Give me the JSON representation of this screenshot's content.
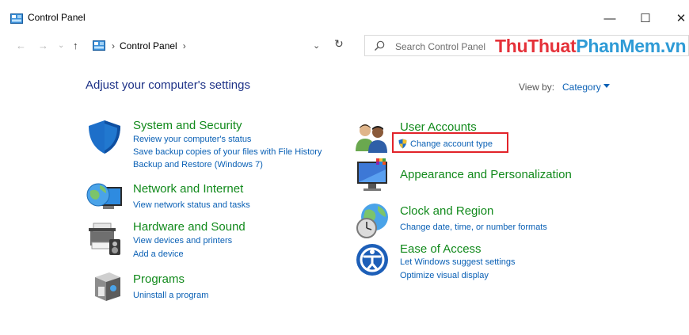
{
  "window": {
    "title": "Control Panel",
    "minimize": "—",
    "maximize": "☐",
    "close": "✕"
  },
  "nav": {
    "back": "←",
    "forward": "→",
    "history": "⌄",
    "up": "↑",
    "breadcrumb": [
      "Control Panel"
    ],
    "breadcrumb_sep": "›",
    "dropdown": "⌄",
    "refresh": "↻",
    "search_placeholder": "Search Control Panel"
  },
  "watermark": {
    "part1": "ThuThuat",
    "part2": "PhanMem.vn"
  },
  "main": {
    "heading": "Adjust your computer's settings",
    "view_by_label": "View by:",
    "view_by_value": "Category"
  },
  "categories": {
    "system": {
      "title": "System and Security",
      "links": [
        "Review your computer's status",
        "Save backup copies of your files with File History",
        "Backup and Restore (Windows 7)"
      ]
    },
    "network": {
      "title": "Network and Internet",
      "links": [
        "View network status and tasks"
      ]
    },
    "hardware": {
      "title": "Hardware and Sound",
      "links": [
        "View devices and printers",
        "Add a device"
      ]
    },
    "programs": {
      "title": "Programs",
      "links": [
        "Uninstall a program"
      ]
    },
    "users": {
      "title": "User Accounts",
      "links": [
        "Change account type"
      ]
    },
    "appearance": {
      "title": "Appearance and Personalization",
      "links": []
    },
    "clock": {
      "title": "Clock and Region",
      "links": [
        "Change date, time, or number formats"
      ]
    },
    "ease": {
      "title": "Ease of Access",
      "links": [
        "Let Windows suggest settings",
        "Optimize visual display"
      ]
    }
  },
  "colors": {
    "category_title": "#128a1c",
    "link": "#0a60b5",
    "heading": "#1e3287",
    "highlight": "#e2232a"
  }
}
